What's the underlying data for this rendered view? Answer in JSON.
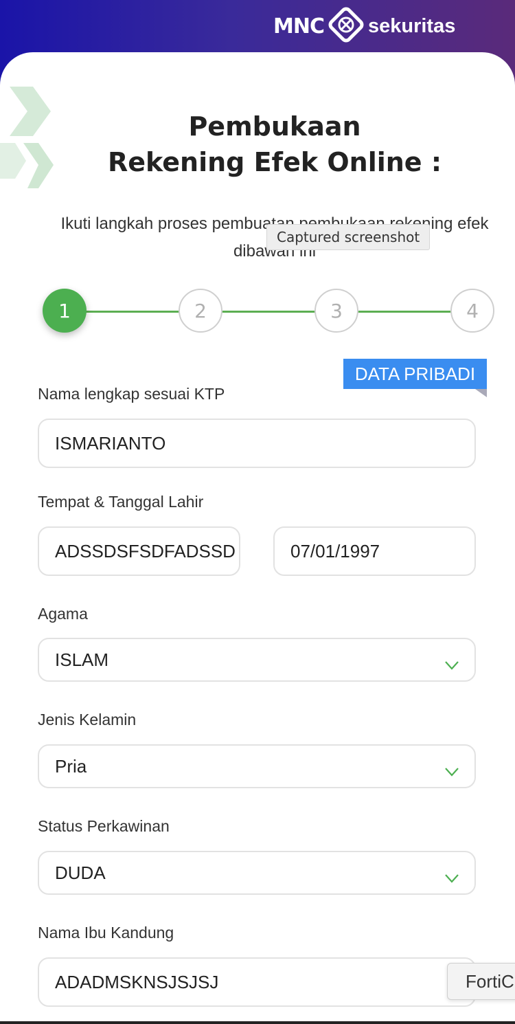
{
  "header": {
    "logo_left": "MNC",
    "logo_right": "sekuritas"
  },
  "page": {
    "title_line1": "Pembukaan",
    "title_line2": "Rekening Efek Online :",
    "subtitle_line1": "Ikuti langkah proses pembuatan pembukaan rekening efek",
    "subtitle_line2": "dibawah ini",
    "tooltip": "Captured screenshot"
  },
  "stepper": {
    "steps": [
      "1",
      "2",
      "3",
      "4"
    ],
    "current_step": 1
  },
  "section": {
    "tag": "DATA PRIBADI"
  },
  "form": {
    "nama_label": "Nama lengkap sesuai KTP",
    "nama_value": "ISMARIANTO",
    "ttl_label": "Tempat & Tanggal Lahir",
    "tempat_value": "ADSSDSFSDFADSSD",
    "tanggal_value": "07/01/1997",
    "agama_label": "Agama",
    "agama_value": "ISLAM",
    "kelamin_label": "Jenis Kelamin",
    "kelamin_value": "Pria",
    "status_label": "Status Perkawinan",
    "status_value": "DUDA",
    "ibu_label": "Nama Ibu Kandung",
    "ibu_value": "ADADMSKNSJSJSJ"
  },
  "overlay": {
    "forti_label": "FortiC"
  },
  "colors": {
    "brand_gradient_start": "#1a14a8",
    "brand_gradient_end": "#5a2a7a",
    "step_active": "#4caf50",
    "section_tag": "#3a8df0",
    "chevron": "#4caf50"
  }
}
